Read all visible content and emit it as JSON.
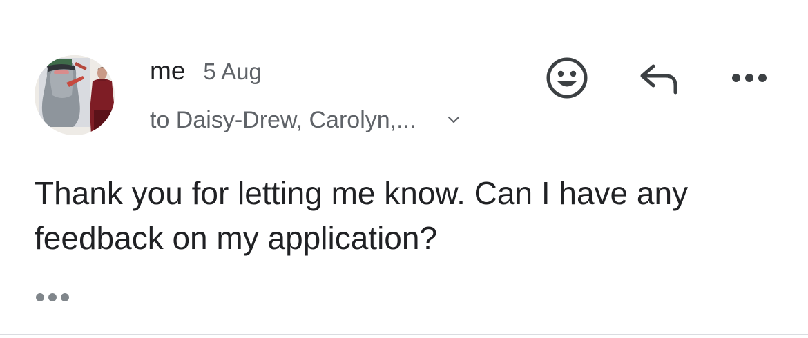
{
  "message": {
    "sender": "me",
    "date": "5 Aug",
    "recipients": "to Daisy-Drew, Carolyn,...",
    "body": "Thank you for letting me know. Can I have any feedback on my application?"
  },
  "icons": {
    "emoji": "smiley-face-icon",
    "reply": "reply-arrow-icon",
    "more": "more-horizontal-icon",
    "expand": "chevron-down-icon",
    "trimmed": "ellipsis-icon"
  },
  "colors": {
    "primary_text": "#202124",
    "secondary_text": "#5f6368",
    "icon": "#3c4043",
    "trimmed_dots": "#80868b",
    "divider": "#dadce0"
  }
}
